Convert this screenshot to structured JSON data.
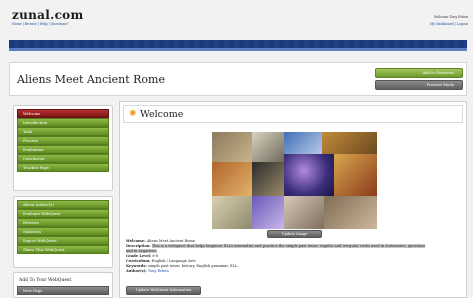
{
  "header": {
    "logo": "zunal.com",
    "subnav": "Home | Browse | Help | Questions?",
    "welcome_text": "Welcome Tony Erben",
    "dashboard_link": "My Dashboard",
    "logout_link": "Logout",
    "separator": " | "
  },
  "titlebar": {
    "title": "Aliens Meet Ancient Rome",
    "add_favorites": "Add to Favorites",
    "preview_mode": "Preview Mode"
  },
  "sidebar": {
    "nav1": [
      "Welcome",
      "Introduction",
      "Task",
      "Process",
      "Evaluation",
      "Conclusion",
      "Teacher Page"
    ],
    "nav2": [
      "About Author(s)",
      "Evaluate WebQuest",
      "Reviews",
      "Statistics",
      "Export WebQuest",
      "Share This WebQuest"
    ],
    "add_title": "Add To Your WebQuest",
    "new_page": "New Page"
  },
  "main": {
    "section_title": "Welcome",
    "update_image": "Update Image",
    "welcome_label": "Welcome:",
    "welcome_value": "Aliens Meet Ancient Rome",
    "description_label": "Description:",
    "description_value": "This is a webquest that helps beginner ELLs internalize and practice the simple past tense: regular and irregular verbs used in statements, questions and in negatives.",
    "grade_label": "Grade Level:",
    "grade_value": "6-8",
    "curriculum_label": "Curriculum:",
    "curriculum_value": "English / Language Arts",
    "keywords_label": "Keywords:",
    "keywords_value": "simple past tense, history, English grammar, ELL,",
    "authors_label": "Author(s):",
    "authors_value": "Tony Erben",
    "update_info": "Update WebQuest Information"
  },
  "colors": {
    "nav_green": "#6e9b2e",
    "nav_active_red": "#9a1f1f",
    "header_stripe": "#1b3b78",
    "button_grey": "#6f6f6f"
  }
}
